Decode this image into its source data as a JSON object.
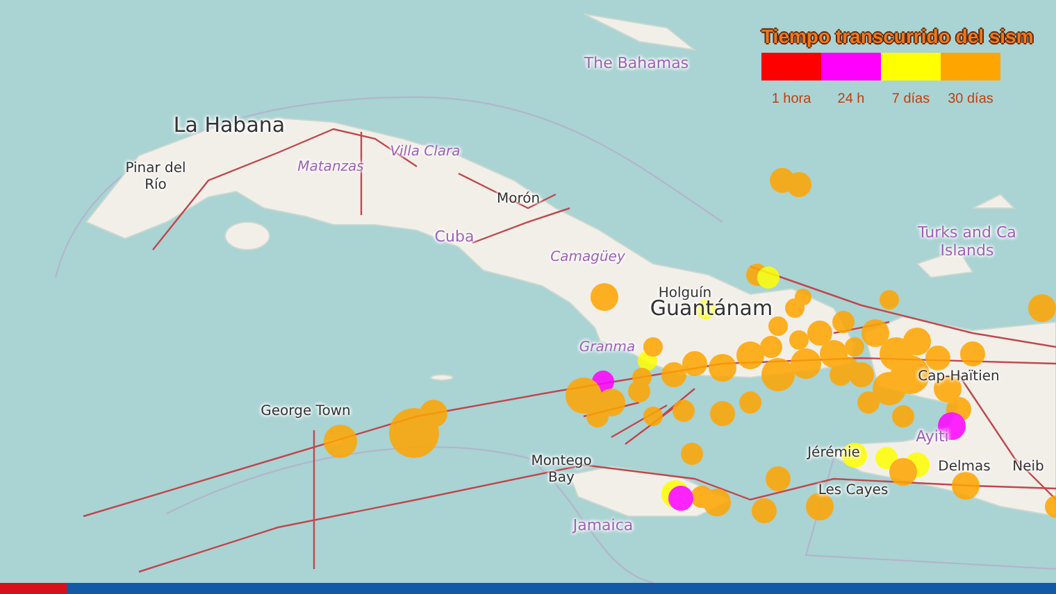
{
  "map": {
    "places": [
      {
        "name": "The Bahamas",
        "kind": "country"
      },
      {
        "name": "La Habana",
        "kind": "capital"
      },
      {
        "name": "Pinar del\nRío",
        "kind": "city"
      },
      {
        "name": "Matanzas",
        "kind": "region"
      },
      {
        "name": "Villa Clara",
        "kind": "region"
      },
      {
        "name": "Morón",
        "kind": "city"
      },
      {
        "name": "Cuba",
        "kind": "country"
      },
      {
        "name": "Camagüey",
        "kind": "region"
      },
      {
        "name": "Holguín",
        "kind": "city"
      },
      {
        "name": "Granma",
        "kind": "region"
      },
      {
        "name": "Guantánam",
        "kind": "capital"
      },
      {
        "name": "Turks and Ca\nIslands",
        "kind": "country"
      },
      {
        "name": "Cap-Haïtien",
        "kind": "city"
      },
      {
        "name": "George Town",
        "kind": "city"
      },
      {
        "name": "Montego\nBay",
        "kind": "city"
      },
      {
        "name": "Jamaica",
        "kind": "country"
      },
      {
        "name": "Jérémie",
        "kind": "city"
      },
      {
        "name": "Ayiti",
        "kind": "country"
      },
      {
        "name": "Les Cayes",
        "kind": "city"
      },
      {
        "name": "Delmas",
        "kind": "city"
      },
      {
        "name": "Neib",
        "kind": "city"
      }
    ]
  },
  "legend": {
    "title": "Tiempo transcurrido del sism",
    "items": [
      {
        "label": "1 hora",
        "color": "#ff0000"
      },
      {
        "label": "24 h",
        "color": "#ff00ff"
      },
      {
        "label": "7 días",
        "color": "#ffff00"
      },
      {
        "label": "30 días",
        "color": "#ffa500"
      }
    ]
  }
}
